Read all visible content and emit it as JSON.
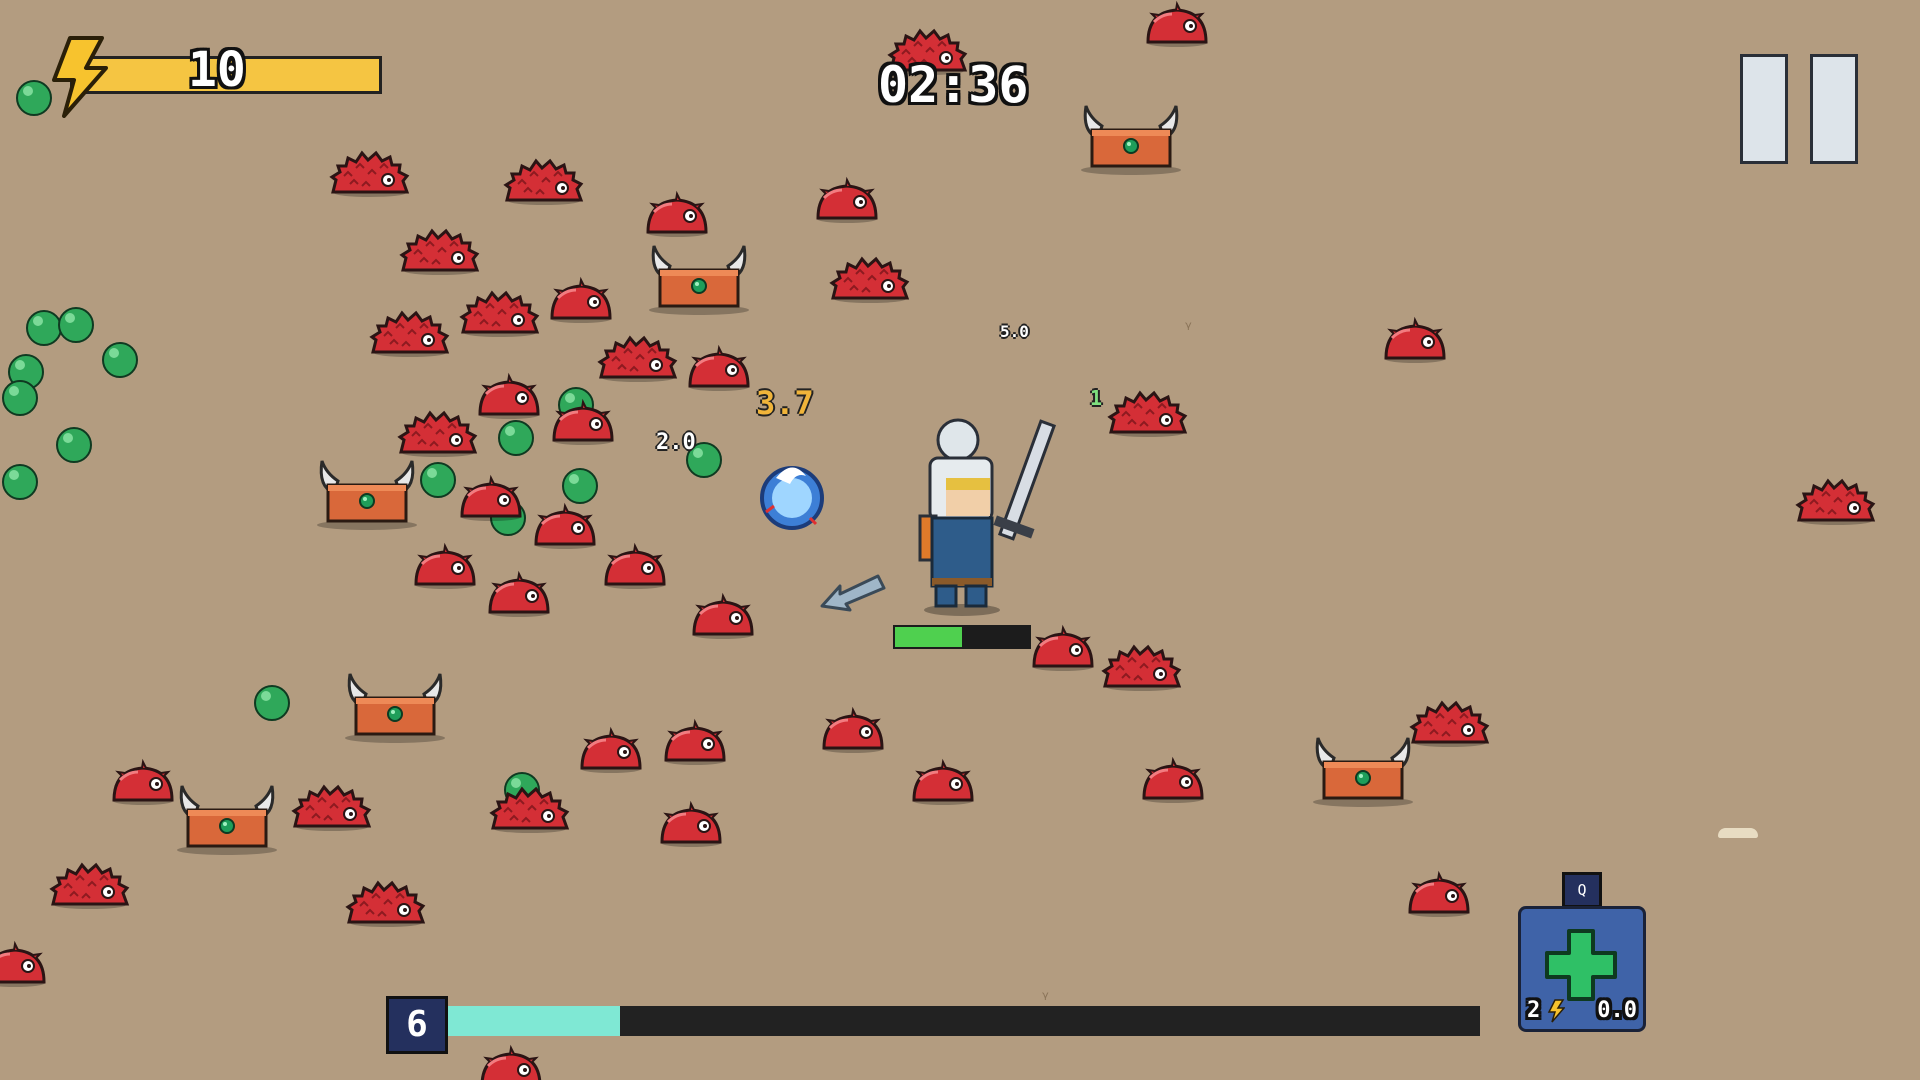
{
  "hud": {
    "energy_value": "10",
    "energy_fill": 1.0,
    "timer": "02:36",
    "level": "6",
    "xp_progress": 0.17,
    "health_fill": 0.5
  },
  "ability": {
    "hotkey": "Q",
    "cost": "2",
    "cooldown": "0.0"
  },
  "damage_numbers": [
    {
      "text": "3.7",
      "color": "#f0b43a"
    },
    {
      "text": "2.0",
      "color": "#ffffff"
    },
    {
      "text": "5.0",
      "color": "#ffffff"
    },
    {
      "text": "1",
      "color": "#7fe07f"
    }
  ],
  "colors": {
    "ground": "#b39c80",
    "enemy_red": "#d42f36",
    "xp_orb": "#2fa85a",
    "energy_bar": "#f5c542",
    "xp_bar": "#7fe8d4"
  },
  "icons": [
    "lightning-icon",
    "pause-icon",
    "heal-cross-icon"
  ]
}
